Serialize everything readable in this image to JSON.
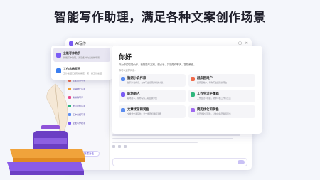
{
  "headline": "智能写作助理，满足各种文案创作场景",
  "window": {
    "title": "AI写作",
    "controls": [
      "—",
      "▢",
      "✕"
    ],
    "new_chat": "+ 新建对话"
  },
  "popup": {
    "items": [
      {
        "title": "全能写作助手",
        "desc": "智能写作助理，满足各种文案创作场景",
        "color": "#7a5cf5"
      },
      {
        "title": "工作总结写手",
        "desc": "工作总结汇报轻松搞定，帮一键工作总结",
        "color": "#3a7ef0"
      }
    ]
  },
  "sidebar": {
    "items": [
      {
        "label": "全能写作助手",
        "sub": "智能写作助理",
        "color": "#7a5cf5"
      },
      {
        "label": "工作总结写手",
        "sub": "一键工作总结",
        "color": "#3a7ef0"
      },
      {
        "label": "企业宣传写手",
        "sub": "宣传文案",
        "color": "#f06a4a"
      },
      {
        "label": "营销推广写手",
        "sub": "推广文案",
        "color": "#f0a030"
      },
      {
        "label": "演讲稿写手",
        "sub": "演讲稿",
        "color": "#e64a8b"
      },
      {
        "label": "学习总结写手",
        "sub": "学习总结",
        "color": "#2eb67d"
      }
    ]
  },
  "panel": {
    "greeting": "你好",
    "description": "作为你的智能伙伴，我既能写文案、想点子，又能陪你聊天、答疑解惑。",
    "tip": "你可以这样问我：",
    "cards": [
      {
        "title": "脑洞小说作家",
        "desc": "脑洞小说作家，为你写出奇思妙想的小说",
        "color": "#5b8cf0"
      },
      {
        "title": "起床困难户",
        "desc": "起床困难户，帮你写出起床的理由",
        "color": "#f06a4a"
      },
      {
        "title": "职场新人",
        "desc": "职场新人，帮你写好入职自我介绍",
        "color": "#7a5cf5"
      },
      {
        "title": "工作生活平衡器",
        "desc": "工作生活平衡器，帮你平衡工作与生活",
        "color": "#2eb67d"
      },
      {
        "title": "文章优化和润色",
        "desc": "文章优化和润色，让文章更加通顺流畅",
        "color": "#5b8cf0"
      },
      {
        "title": "简历优化和润色",
        "desc": "简历优化和润色，让你的简历脱颖而出",
        "color": "#a06af0"
      }
    ]
  },
  "chat": {
    "name": "全能写作",
    "text": "写一篇关于工作总结的文章，标题是一个有关于工作生活平衡的内容，一个精彩的表述……"
  }
}
